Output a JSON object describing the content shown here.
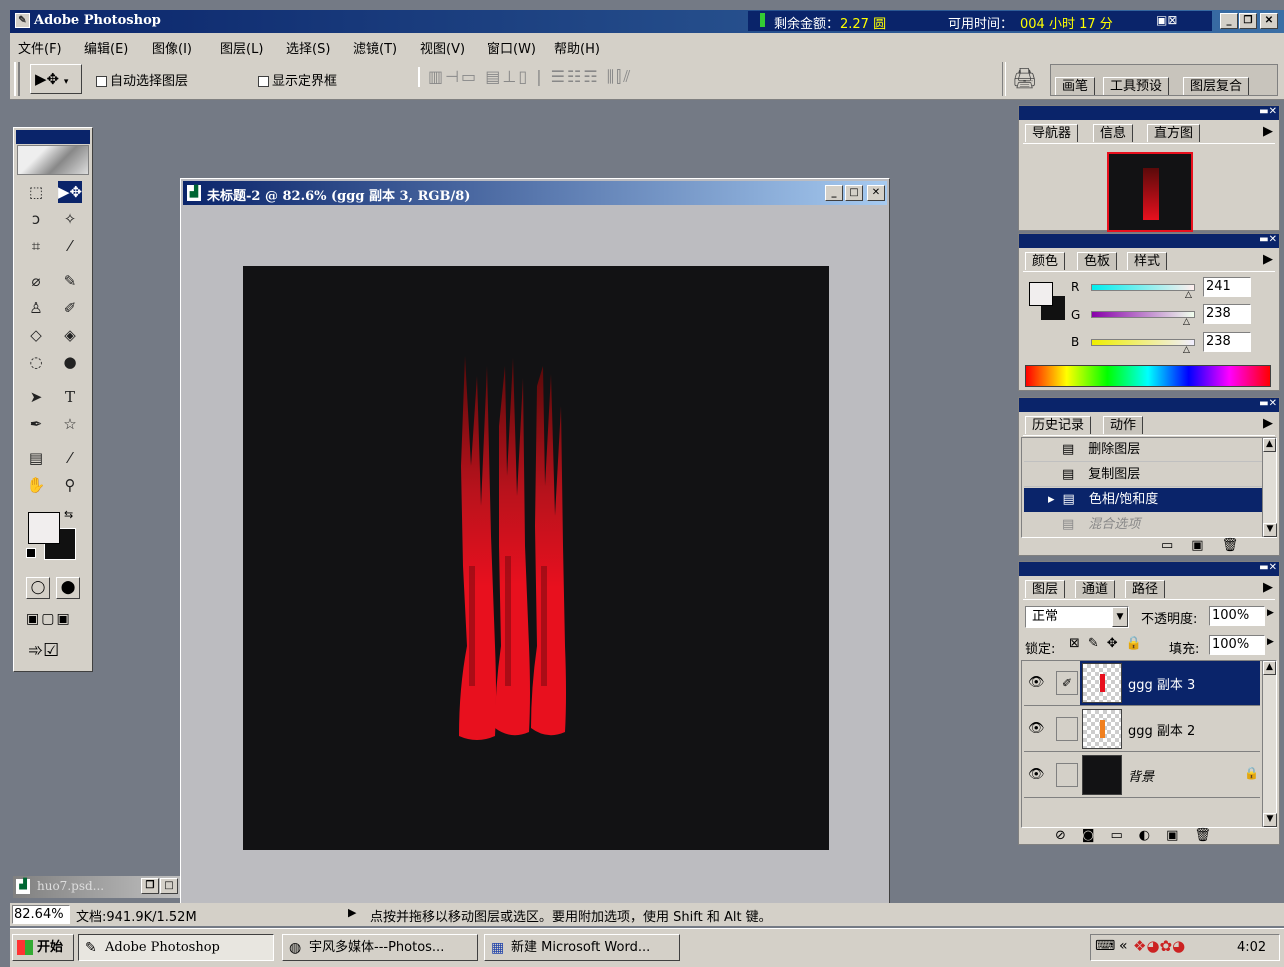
{
  "app": {
    "title": "Adobe Photoshop",
    "balance_label": "剩余金额：",
    "balance_value": "2.27 圆",
    "time_label": "可用时间：",
    "time_value": "004 小时 17 分"
  },
  "menu": [
    "文件(F)",
    "编辑(E)",
    "图像(I)",
    "图层(L)",
    "选择(S)",
    "滤镜(T)",
    "视图(V)",
    "窗口(W)",
    "帮助(H)"
  ],
  "options": {
    "auto_select": "自动选择图层",
    "show_bounds": "显示定界框",
    "palette_tabs": [
      "画笔",
      "工具预设",
      "图层复合"
    ]
  },
  "document": {
    "title": "未标题-2 @ 82.6% (ggg 副本 3, RGB/8)",
    "bg_color": "#121214",
    "art_color": "#e8101e"
  },
  "navigator": {
    "tabs": [
      "导航器",
      "信息",
      "直方图"
    ]
  },
  "color_panel": {
    "tabs": [
      "颜色",
      "色板",
      "样式"
    ],
    "channels": [
      {
        "label": "R",
        "value": "241"
      },
      {
        "label": "G",
        "value": "238"
      },
      {
        "label": "B",
        "value": "238"
      }
    ]
  },
  "history": {
    "tabs": [
      "历史记录",
      "动作"
    ],
    "items": [
      "删除图层",
      "复制图层",
      "色相/饱和度",
      "混合选项"
    ],
    "selected_index": 2
  },
  "layers": {
    "tabs": [
      "图层",
      "通道",
      "路径"
    ],
    "blend_mode": "正常",
    "opacity_label": "不透明度:",
    "opacity_value": "100%",
    "lock_label": "锁定:",
    "fill_label": "填充:",
    "fill_value": "100%",
    "items": [
      {
        "name": "ggg 副本 3",
        "selected": true
      },
      {
        "name": "ggg 副本 2",
        "selected": false
      },
      {
        "name": "背景",
        "selected": false
      }
    ]
  },
  "minimized_doc": "huo7.psd...",
  "status": {
    "zoom": "82.64%",
    "doc_size": "文档:941.9K/1.52M",
    "hint": "点按并拖移以移动图层或选区。要用附加选项，使用 Shift 和 Alt 键。"
  },
  "taskbar": {
    "start": "开始",
    "tasks": [
      "Adobe Photoshop",
      "宇风多媒体---Photos...",
      "新建 Microsoft Word..."
    ],
    "clock": "4:02"
  }
}
